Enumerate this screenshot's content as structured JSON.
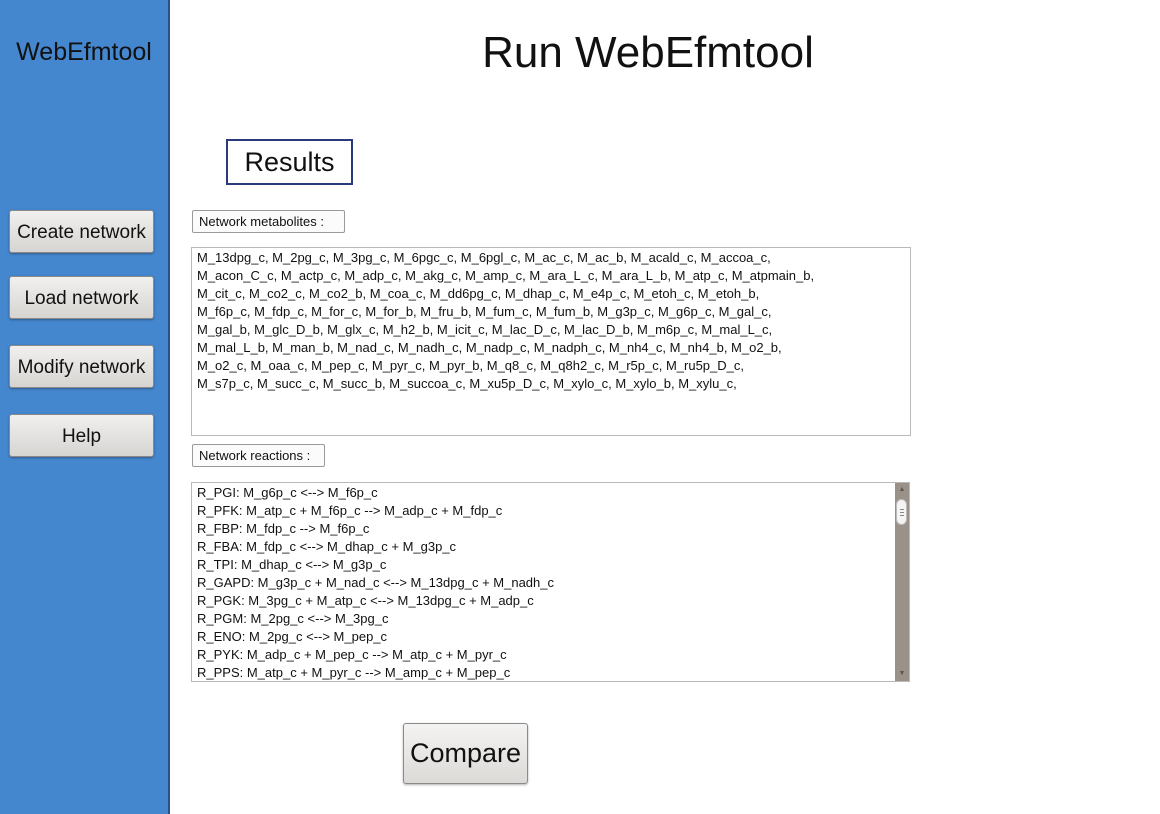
{
  "sidebar": {
    "app_title": "WebEfmtool",
    "buttons": [
      "Create network",
      "Load network",
      "Modify network",
      "Help"
    ]
  },
  "main": {
    "page_title": "Run WebEfmtool",
    "results_label": "Results",
    "metabolites_label": "Network metabolites :",
    "metabolites_lines": [
      "M_13dpg_c, M_2pg_c, M_3pg_c, M_6pgc_c, M_6pgl_c, M_ac_c, M_ac_b, M_acald_c, M_accoa_c,",
      "M_acon_C_c, M_actp_c, M_adp_c, M_akg_c, M_amp_c, M_ara_L_c, M_ara_L_b, M_atp_c, M_atpmain_b,",
      "M_cit_c, M_co2_c, M_co2_b, M_coa_c, M_dd6pg_c, M_dhap_c, M_e4p_c, M_etoh_c, M_etoh_b,",
      "M_f6p_c, M_fdp_c, M_for_c, M_for_b, M_fru_b, M_fum_c, M_fum_b, M_g3p_c, M_g6p_c, M_gal_c,",
      "M_gal_b, M_glc_D_b, M_glx_c, M_h2_b, M_icit_c, M_lac_D_c, M_lac_D_b, M_m6p_c, M_mal_L_c,",
      "M_mal_L_b, M_man_b, M_nad_c, M_nadh_c, M_nadp_c, M_nadph_c, M_nh4_c, M_nh4_b, M_o2_b,",
      "M_o2_c, M_oaa_c, M_pep_c, M_pyr_c, M_pyr_b, M_q8_c, M_q8h2_c, M_r5p_c, M_ru5p_D_c,",
      "M_s7p_c, M_succ_c, M_succ_b, M_succoa_c, M_xu5p_D_c, M_xylo_c, M_xylo_b, M_xylu_c,"
    ],
    "reactions_label": "Network reactions :",
    "reactions_lines": [
      "R_PGI: M_g6p_c <--> M_f6p_c",
      "R_PFK: M_atp_c + M_f6p_c --> M_adp_c + M_fdp_c",
      "R_FBP: M_fdp_c --> M_f6p_c",
      "R_FBA: M_fdp_c <--> M_dhap_c + M_g3p_c",
      "R_TPI: M_dhap_c <--> M_g3p_c",
      "R_GAPD: M_g3p_c + M_nad_c <--> M_13dpg_c + M_nadh_c",
      "R_PGK: M_3pg_c + M_atp_c <--> M_13dpg_c + M_adp_c",
      "R_PGM: M_2pg_c <--> M_3pg_c",
      "R_ENO: M_2pg_c <--> M_pep_c",
      "R_PYK: M_adp_c + M_pep_c --> M_atp_c + M_pyr_c",
      "R_PPS: M_atp_c + M_pyr_c --> M_amp_c + M_pep_c"
    ],
    "compare_label": "Compare"
  },
  "icons": {
    "scroll_up": "triangle-up-icon",
    "scroll_down": "triangle-down-icon"
  },
  "colors": {
    "sidebar_bg": "#4587cf",
    "results_border": "#2a3a7a",
    "scrollbar_track": "#9a9189"
  }
}
